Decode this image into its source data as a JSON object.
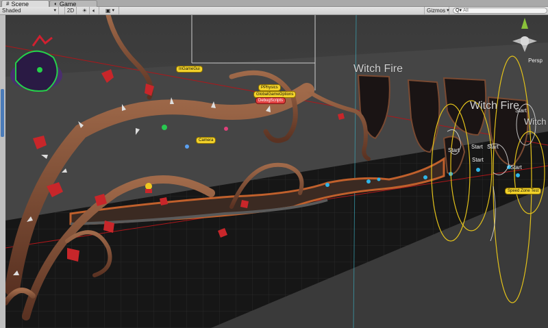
{
  "tabs": [
    {
      "label": "Scene",
      "icon": "scene-icon",
      "active": true
    },
    {
      "label": "Game",
      "icon": "game-icon",
      "active": false
    }
  ],
  "toolbar": {
    "draw_mode": "Shaded",
    "mode_2d": "2D",
    "gizmos": "Gizmos",
    "search_prefix": "Q▾",
    "search_placeholder": "All"
  },
  "scene": {
    "persp_label": "Persp",
    "labels_3d": [
      "Witch Fire",
      "Witch Fire",
      "Witch"
    ],
    "tags": {
      "ingamegui": "InGameGui",
      "pphysics": "PPhysics",
      "globalgameoptions": "GlobalGameOptions",
      "debugscripts": "DebugScripts",
      "camera": "Camera",
      "speedzonetest": "Speed Zone Test"
    },
    "start_label": "Start",
    "colors": {
      "floor": "#151515",
      "vine_brown": "#7a4a32",
      "leaf_red": "#c8262a",
      "gizmo_yellow": "#e3c21a",
      "gizmo_red_line": "#b0161a"
    }
  }
}
